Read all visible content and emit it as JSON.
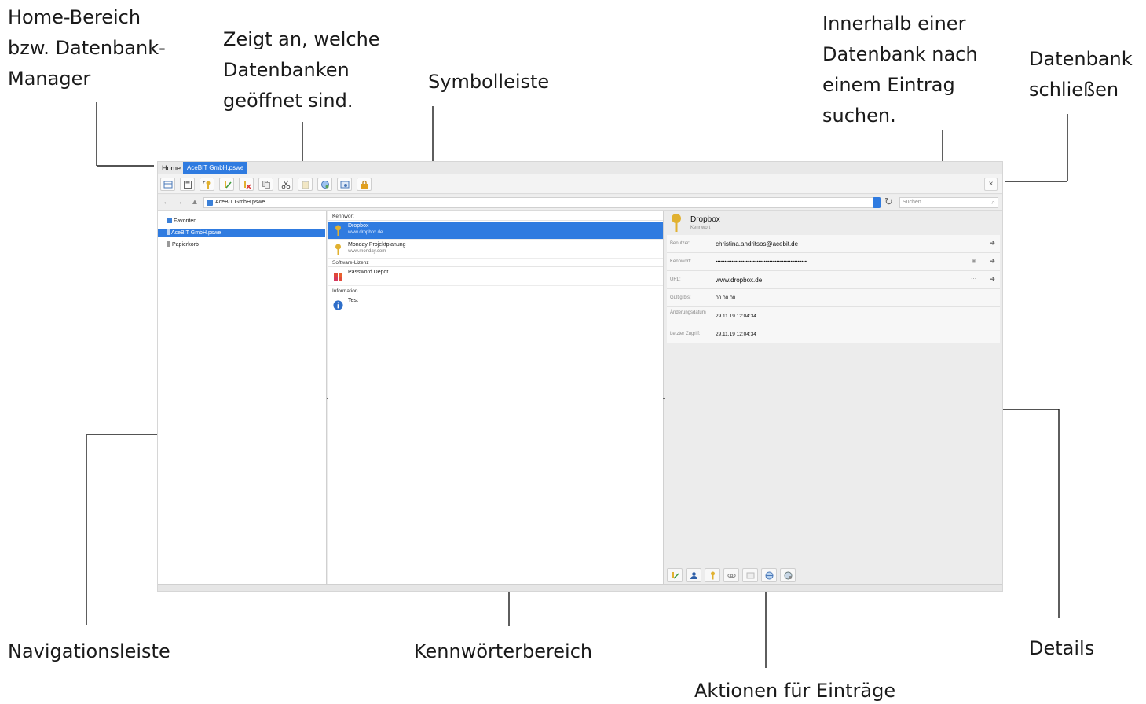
{
  "annotations": {
    "home": [
      "Home-Bereich",
      "bzw. Datenbank-",
      "Manager"
    ],
    "open_dbs": [
      "Zeigt an, welche",
      "Datenbanken",
      "geöffnet sind."
    ],
    "toolbar": [
      "Symbolleiste"
    ],
    "search": [
      "Innerhalb einer",
      "Datenbank nach",
      "einem Eintrag",
      "suchen."
    ],
    "close": [
      "Datenbank",
      "schließen"
    ],
    "navigation": "Navigationsleiste",
    "password_area": "Kennwörterbereich",
    "details": "Details",
    "entry_actions": "Aktionen für Einträge"
  },
  "app": {
    "tabs": {
      "home": "Home",
      "database": "AceBIT GmbH.pswe"
    },
    "close_label": "×",
    "path": "AceBIT GmbH.pswe",
    "search_placeholder": "Suchen",
    "toolbar_icons": [
      "table-icon",
      "save-icon",
      "new-key-icon",
      "edit-icon",
      "delete-icon",
      "copy-icon",
      "cut-icon",
      "paste-icon",
      "open-url-icon",
      "view-icon",
      "lock-icon"
    ],
    "nav_items": [
      {
        "label": "Favoriten",
        "icon": "favorites-icon"
      },
      {
        "label": "AceBIT GmbH.pswe",
        "icon": "database-icon",
        "selected": true
      },
      {
        "label": "Papierkorb",
        "icon": "trash-icon"
      }
    ],
    "groups": {
      "g1": "Kennwort",
      "g2": "Software-Lizenz",
      "g3": "Information"
    },
    "entries": [
      {
        "title": "Dropbox",
        "sub": "www.dropbox.de",
        "icon": "key-icon",
        "selected": true
      },
      {
        "title": "Monday Projektplanung",
        "sub": "www.monday.com",
        "icon": "key-icon"
      },
      {
        "title": "Password Depot",
        "sub": "",
        "icon": "windows-icon"
      },
      {
        "title": "Test",
        "sub": "",
        "icon": "info-icon"
      }
    ],
    "details": {
      "name": "Dropbox",
      "kind": "Kennwort",
      "fields": [
        {
          "label": "Benutzer:",
          "value": "christina.andritsos@acebit.de"
        },
        {
          "label": "Kennwort:",
          "value": "•••••••••••••••••••••••••••••••••••••••••••••••••••"
        },
        {
          "label": "URL:",
          "value": "www.dropbox.de"
        },
        {
          "label": "Gültig bis:",
          "value": "00.00.00"
        },
        {
          "label": "Änderungsdatum",
          "value": "29.11.19 12:04:34"
        },
        {
          "label": "Letzter Zugriff:",
          "value": "29.11.19 12:04:34"
        }
      ]
    },
    "action_icons": [
      "edit-entry-icon",
      "user-icon",
      "key-copy-icon",
      "link-icon",
      "note-icon",
      "globe-icon",
      "globe-settings-icon"
    ],
    "colors": {
      "accent": "#2f7be0",
      "key": "#e1b130"
    }
  }
}
